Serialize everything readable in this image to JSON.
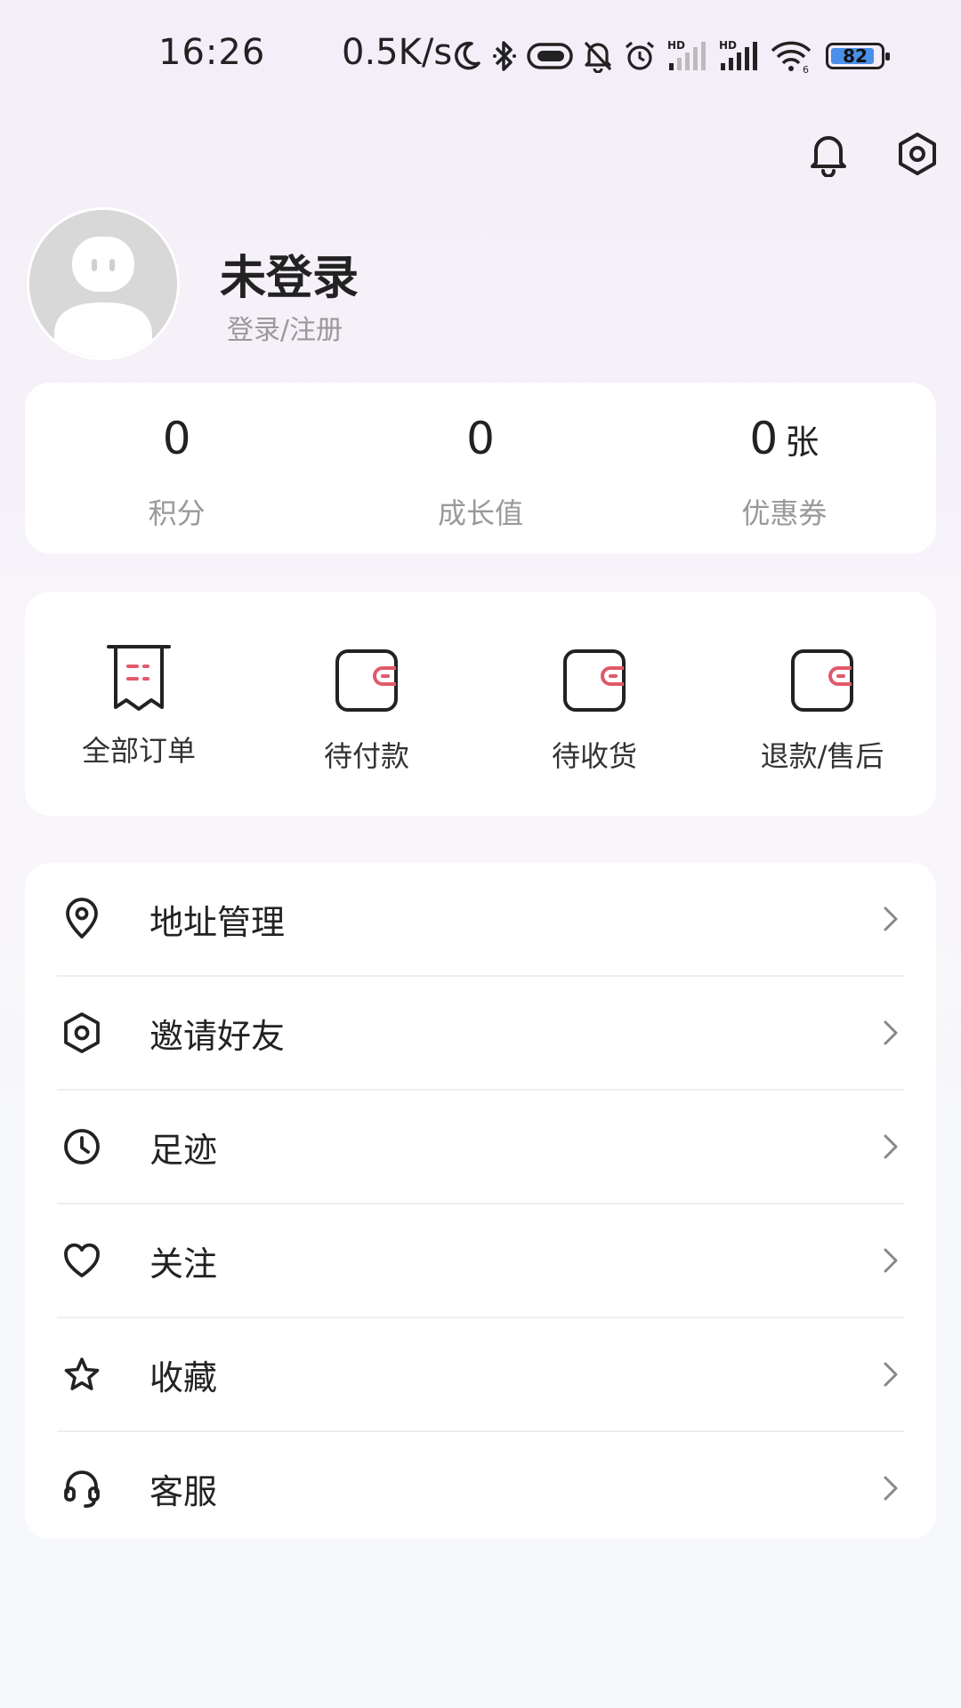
{
  "status_bar": {
    "time": "16:26",
    "net_speed": "0.5K/s",
    "battery": "82",
    "icons": [
      "moon-icon",
      "bluetooth-icon",
      "toggle-icon",
      "mute-bell-icon",
      "alarm-icon",
      "signal-hd-icon",
      "signal-hd-icon",
      "wifi-icon",
      "battery-icon"
    ]
  },
  "header": {
    "icons": [
      "bell-icon",
      "settings-hexagon-icon"
    ]
  },
  "profile": {
    "name": "未登录",
    "subtitle": "登录/注册"
  },
  "stats": [
    {
      "value": "0",
      "unit": "",
      "label": "积分"
    },
    {
      "value": "0",
      "unit": "",
      "label": "成长值"
    },
    {
      "value": "0",
      "unit": "张",
      "label": "优惠券"
    }
  ],
  "orders": [
    {
      "label": "全部订单",
      "icon": "receipt-icon"
    },
    {
      "label": "待付款",
      "icon": "wallet-icon"
    },
    {
      "label": "待收货",
      "icon": "wallet-icon"
    },
    {
      "label": "退款/售后",
      "icon": "wallet-icon"
    }
  ],
  "menu": [
    {
      "label": "地址管理",
      "icon": "location-pin-icon"
    },
    {
      "label": "邀请好友",
      "icon": "hexagon-icon"
    },
    {
      "label": "足迹",
      "icon": "clock-icon"
    },
    {
      "label": "关注",
      "icon": "heart-icon"
    },
    {
      "label": "收藏",
      "icon": "star-icon"
    },
    {
      "label": "客服",
      "icon": "headset-icon"
    }
  ],
  "colors": {
    "accent": "#e05a6a",
    "text_primary": "#222222",
    "text_secondary": "#999999",
    "card_bg": "#ffffff"
  }
}
